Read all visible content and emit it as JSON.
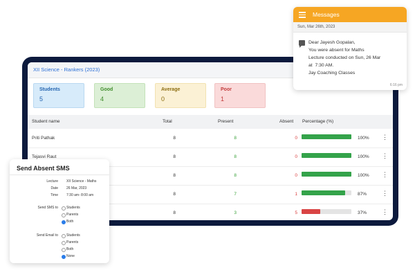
{
  "screen": {
    "title": "XII Science - Rankers (2023)",
    "cards": [
      {
        "label": "Students",
        "value": "5"
      },
      {
        "label": "Good",
        "value": "4"
      },
      {
        "label": "Average",
        "value": "0"
      },
      {
        "label": "Poor",
        "value": "1"
      }
    ],
    "columns": [
      "Student name",
      "Total",
      "Present",
      "Absent",
      "Percentage (%)"
    ],
    "rows": [
      {
        "name": "Priti Pathak",
        "total": "8",
        "present": "8",
        "absent": "0",
        "percent": "100%",
        "progress": 100,
        "bar_color": "#34a34a"
      },
      {
        "name": "Tejasvi Raut",
        "total": "8",
        "present": "8",
        "absent": "0",
        "percent": "100%",
        "progress": 100,
        "bar_color": "#34a34a"
      },
      {
        "name": "",
        "total": "8",
        "present": "8",
        "absent": "0",
        "percent": "100%",
        "progress": 100,
        "bar_color": "#34a34a"
      },
      {
        "name": "",
        "total": "8",
        "present": "7",
        "absent": "1",
        "percent": "87%",
        "progress": 87,
        "bar_color": "#34a34a"
      },
      {
        "name": "",
        "total": "8",
        "present": "3",
        "absent": "5",
        "percent": "37%",
        "progress": 37,
        "bar_color": "#d94444"
      }
    ]
  },
  "messages": {
    "title": "Messages",
    "date": "Sun, Mar 26th, 2023",
    "body": "Dear Jayesh Gopalan,\nYou were absent for Maths\nLecture conducted on Sun, 26 Mar\nat  7:30 AM.\nJay Coaching Classes",
    "time": "6:16 pm",
    "menu_icon": "hamburger-icon",
    "chat_icon": "message-icon"
  },
  "sms_dialog": {
    "title": "Send Absent SMS",
    "lecture_label": "Lecture",
    "lecture_value": "XII Science - Maths",
    "date_label": "Date",
    "date_value": "26 Mar, 2023",
    "time_label": "Time",
    "time_value": "7:30 am- 8:00 am",
    "sms_label": "Send SMS to",
    "sms_options": [
      {
        "label": "Students",
        "selected": false
      },
      {
        "label": "Parents",
        "selected": false
      },
      {
        "label": "Both",
        "selected": true
      }
    ],
    "email_label": "Send Email to",
    "email_options": [
      {
        "label": "Students",
        "selected": false
      },
      {
        "label": "Parents",
        "selected": false
      },
      {
        "label": "Both",
        "selected": false
      },
      {
        "label": "None",
        "selected": true
      }
    ]
  }
}
